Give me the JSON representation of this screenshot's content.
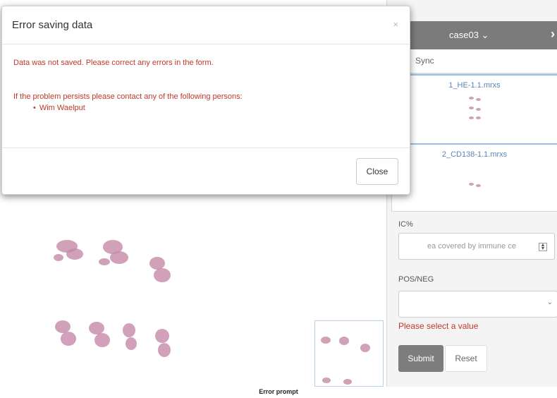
{
  "modal": {
    "title": "Error saving data",
    "close_x": "×",
    "message": "Data was not saved. Please correct any errors in the form.",
    "contact_intro": "If the problem persists please contact any of the following persons:",
    "contacts": [
      "Wim Waelput"
    ],
    "close_button": "Close"
  },
  "sidebar": {
    "case_label": "case03 ⌄",
    "close_glyph": "›",
    "sync_label": "Sync",
    "slides": [
      {
        "label": "1_HE-1.1.mrxs"
      },
      {
        "label": "2_CD138-1.1.mrxs"
      }
    ],
    "ic_label": "IC%",
    "ic_placeholder": "ea covered by immune ce",
    "posneg_label": "POS/NEG",
    "posneg_value": "",
    "validation_error": "Please select a value",
    "submit_label": "Submit",
    "reset_label": "Reset"
  },
  "caption": "Error prompt",
  "colors": {
    "error": "#c0392b",
    "sidebar_header": "#7b7b7b",
    "link": "#5b84b5"
  }
}
